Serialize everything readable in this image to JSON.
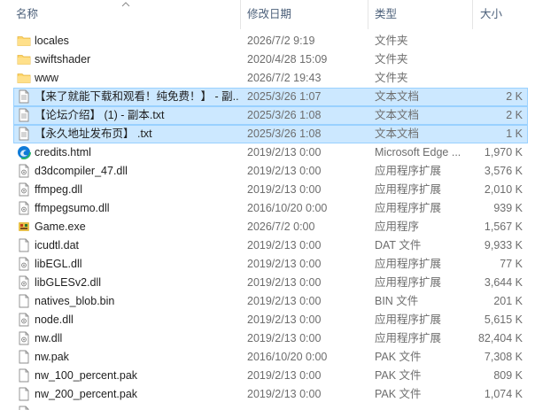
{
  "columns": {
    "name": "名称",
    "date": "修改日期",
    "type": "类型",
    "size": "大小"
  },
  "rows": [
    {
      "name": "locales",
      "date": "2026/7/2 9:19",
      "type": "文件夹",
      "size": "",
      "icon": "folder-icon",
      "selected": false
    },
    {
      "name": "swiftshader",
      "date": "2020/4/28 15:09",
      "type": "文件夹",
      "size": "",
      "icon": "folder-icon",
      "selected": false
    },
    {
      "name": "www",
      "date": "2026/7/2 19:43",
      "type": "文件夹",
      "size": "",
      "icon": "folder-icon",
      "selected": false
    },
    {
      "name": "【来了就能下载和观看！纯免费！】 - 副...",
      "date": "2025/3/26 1:07",
      "type": "文本文档",
      "size": "2 K",
      "icon": "text-file-icon",
      "selected": true
    },
    {
      "name": "【论坛介绍】 (1) - 副本.txt",
      "date": "2025/3/26 1:08",
      "type": "文本文档",
      "size": "2 K",
      "icon": "text-file-icon",
      "selected": true
    },
    {
      "name": "【永久地址发布页】 .txt",
      "date": "2025/3/26 1:08",
      "type": "文本文档",
      "size": "1 K",
      "icon": "text-file-icon",
      "selected": true
    },
    {
      "name": "credits.html",
      "date": "2019/2/13 0:00",
      "type": "Microsoft Edge ...",
      "size": "1,970 K",
      "icon": "edge-icon",
      "selected": false
    },
    {
      "name": "d3dcompiler_47.dll",
      "date": "2019/2/13 0:00",
      "type": "应用程序扩展",
      "size": "3,576 K",
      "icon": "dll-icon",
      "selected": false
    },
    {
      "name": "ffmpeg.dll",
      "date": "2019/2/13 0:00",
      "type": "应用程序扩展",
      "size": "2,010 K",
      "icon": "dll-icon",
      "selected": false
    },
    {
      "name": "ffmpegsumo.dll",
      "date": "2016/10/20 0:00",
      "type": "应用程序扩展",
      "size": "939 K",
      "icon": "dll-icon",
      "selected": false
    },
    {
      "name": "Game.exe",
      "date": "2026/7/2 0:00",
      "type": "应用程序",
      "size": "1,567 K",
      "icon": "game-exe-icon",
      "selected": false
    },
    {
      "name": "icudtl.dat",
      "date": "2019/2/13 0:00",
      "type": "DAT 文件",
      "size": "9,933 K",
      "icon": "blank-file-icon",
      "selected": false
    },
    {
      "name": "libEGL.dll",
      "date": "2019/2/13 0:00",
      "type": "应用程序扩展",
      "size": "77 K",
      "icon": "dll-icon",
      "selected": false
    },
    {
      "name": "libGLESv2.dll",
      "date": "2019/2/13 0:00",
      "type": "应用程序扩展",
      "size": "3,644 K",
      "icon": "dll-icon",
      "selected": false,
      "hover": true
    },
    {
      "name": "natives_blob.bin",
      "date": "2019/2/13 0:00",
      "type": "BIN 文件",
      "size": "201 K",
      "icon": "blank-file-icon",
      "selected": false
    },
    {
      "name": "node.dll",
      "date": "2019/2/13 0:00",
      "type": "应用程序扩展",
      "size": "5,615 K",
      "icon": "dll-icon",
      "selected": false
    },
    {
      "name": "nw.dll",
      "date": "2019/2/13 0:00",
      "type": "应用程序扩展",
      "size": "82,404 K",
      "icon": "dll-icon",
      "selected": false
    },
    {
      "name": "nw.pak",
      "date": "2016/10/20 0:00",
      "type": "PAK 文件",
      "size": "7,308 K",
      "icon": "blank-file-icon",
      "selected": false
    },
    {
      "name": "nw_100_percent.pak",
      "date": "2019/2/13 0:00",
      "type": "PAK 文件",
      "size": "809 K",
      "icon": "blank-file-icon",
      "selected": false
    },
    {
      "name": "nw_200_percent.pak",
      "date": "2019/2/13 0:00",
      "type": "PAK 文件",
      "size": "1,074 K",
      "icon": "blank-file-icon",
      "selected": false
    },
    {
      "name": "",
      "date": "",
      "type": "",
      "size": "",
      "icon": "dll-icon",
      "selected": false
    }
  ],
  "colors": {
    "header_text": "#4c607a",
    "selection_bg": "#cce8ff",
    "selection_border": "#99d1ff",
    "folder": "#ffd66b",
    "secondary_text": "#6d6d6d"
  }
}
